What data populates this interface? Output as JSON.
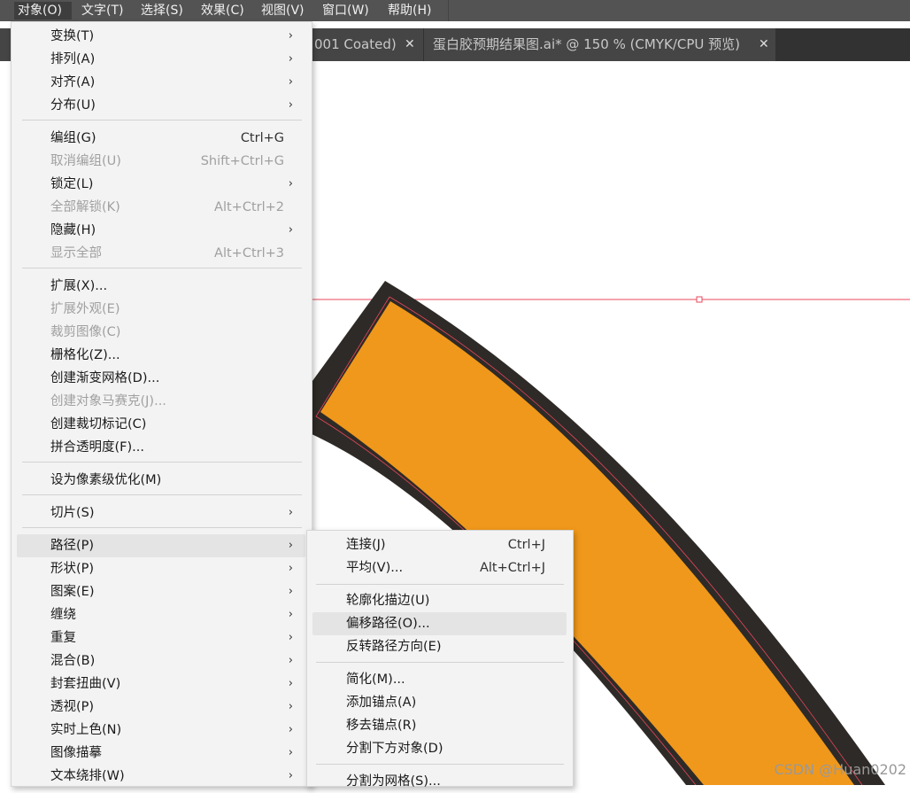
{
  "menubar": {
    "items": [
      {
        "label": "对象(O)",
        "active": true
      },
      {
        "label": "文字(T)"
      },
      {
        "label": "选择(S)"
      },
      {
        "label": "效果(C)"
      },
      {
        "label": "视图(V)"
      },
      {
        "label": "窗口(W)"
      },
      {
        "label": "帮助(H)"
      }
    ]
  },
  "tabs": [
    {
      "title": "001 Coated)",
      "close": "✕"
    },
    {
      "title": "蛋白胶预期结果图.ai* @ 150 % (CMYK/CPU 预览)",
      "close": "✕"
    }
  ],
  "object_menu": {
    "submenu_arrow": "›",
    "items": [
      {
        "label": "变换(T)",
        "submenu": true
      },
      {
        "label": "排列(A)",
        "submenu": true
      },
      {
        "label": "对齐(A)",
        "submenu": true
      },
      {
        "label": "分布(U)",
        "submenu": true
      },
      {
        "label": "编组(G)",
        "shortcut": "Ctrl+G"
      },
      {
        "label": "取消编组(U)",
        "shortcut": "Shift+Ctrl+G",
        "disabled": true
      },
      {
        "label": "锁定(L)",
        "submenu": true
      },
      {
        "label": "全部解锁(K)",
        "shortcut": "Alt+Ctrl+2",
        "disabled": true
      },
      {
        "label": "隐藏(H)",
        "submenu": true
      },
      {
        "label": "显示全部",
        "shortcut": "Alt+Ctrl+3",
        "disabled": true
      },
      {
        "label": "扩展(X)..."
      },
      {
        "label": "扩展外观(E)",
        "disabled": true
      },
      {
        "label": "裁剪图像(C)",
        "disabled": true
      },
      {
        "label": "栅格化(Z)..."
      },
      {
        "label": "创建渐变网格(D)..."
      },
      {
        "label": "创建对象马赛克(J)...",
        "disabled": true
      },
      {
        "label": "创建裁切标记(C)"
      },
      {
        "label": "拼合透明度(F)..."
      },
      {
        "label": "设为像素级优化(M)"
      },
      {
        "label": "切片(S)",
        "submenu": true
      },
      {
        "label": "路径(P)",
        "submenu": true,
        "highlighted": true
      },
      {
        "label": "形状(P)",
        "submenu": true
      },
      {
        "label": "图案(E)",
        "submenu": true
      },
      {
        "label": "缠绕",
        "submenu": true
      },
      {
        "label": "重复",
        "submenu": true
      },
      {
        "label": "混合(B)",
        "submenu": true
      },
      {
        "label": "封套扭曲(V)",
        "submenu": true
      },
      {
        "label": "透视(P)",
        "submenu": true
      },
      {
        "label": "实时上色(N)",
        "submenu": true
      },
      {
        "label": "图像描摹",
        "submenu": true
      },
      {
        "label": "文本绕排(W)",
        "submenu": true
      }
    ]
  },
  "path_submenu": {
    "items": [
      {
        "label": "连接(J)",
        "shortcut": "Ctrl+J"
      },
      {
        "label": "平均(V)...",
        "shortcut": "Alt+Ctrl+J"
      },
      {
        "label": "轮廓化描边(U)"
      },
      {
        "label": "偏移路径(O)...",
        "highlighted": true
      },
      {
        "label": "反转路径方向(E)"
      },
      {
        "label": "简化(M)..."
      },
      {
        "label": "添加锚点(A)"
      },
      {
        "label": "移去锚点(R)"
      },
      {
        "label": "分割下方对象(D)"
      },
      {
        "label": "分割为网格(S)..."
      }
    ]
  },
  "canvas": {
    "shape_fill": "#f0981b",
    "shape_stroke": "#2e2a27",
    "guide_color": "#e8485c",
    "watermark": "CSDN @Huan0202"
  }
}
